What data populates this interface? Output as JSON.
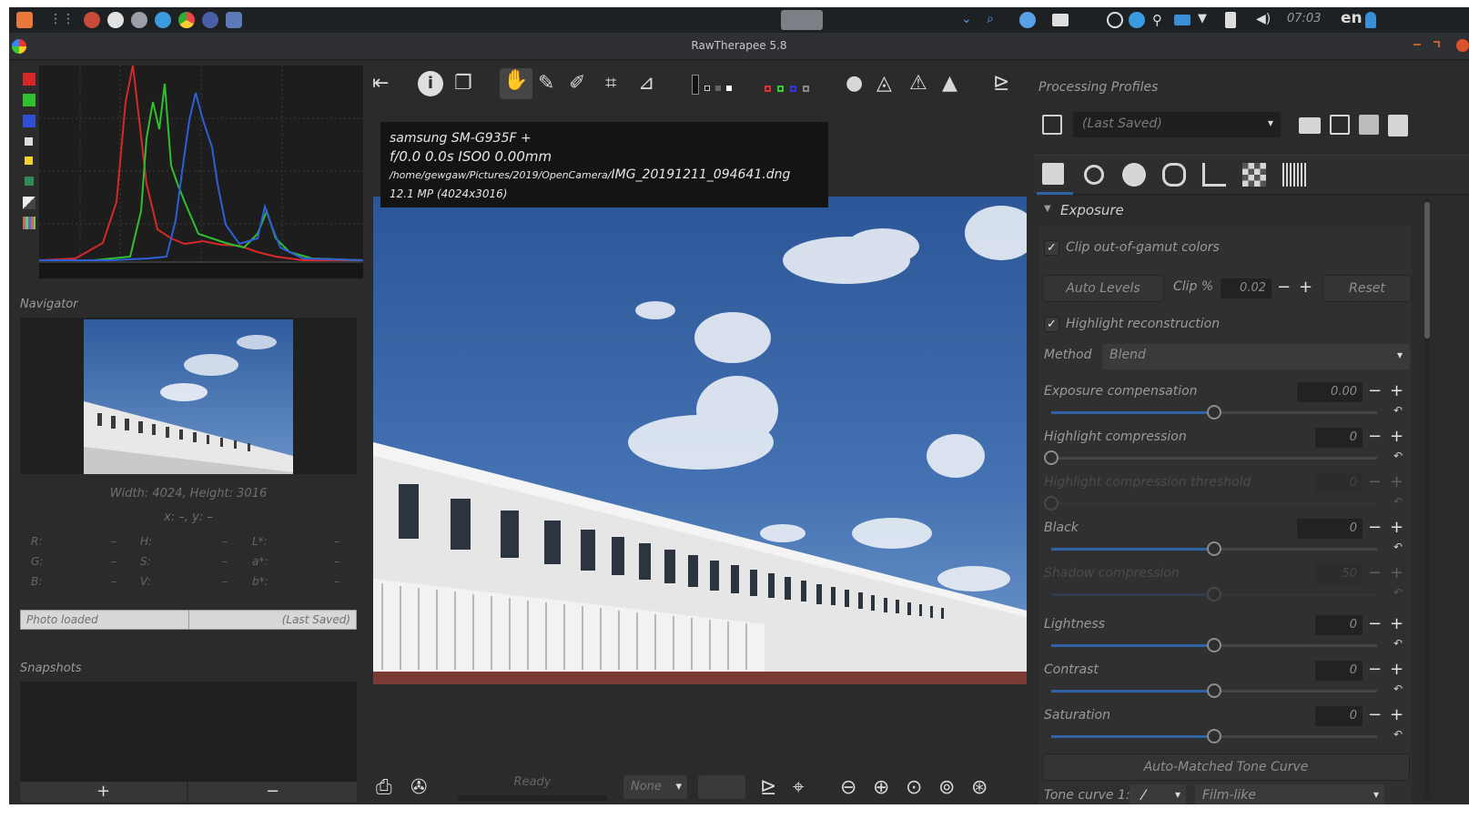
{
  "system_panel": {
    "clock": "07:03",
    "language": "en"
  },
  "window": {
    "title": "RawTherapee 5.8"
  },
  "left_panel": {
    "navigator_title": "Navigator",
    "dimensions": "Width: 4024, Height: 3016",
    "cursor": "x: –, y: –",
    "readouts": [
      {
        "label": "R:",
        "value": "–",
        "label2": "H:",
        "value2": "–",
        "label3": "L*:",
        "value3": "–"
      },
      {
        "label": "G:",
        "value": "–",
        "label2": "S:",
        "value2": "–",
        "label3": "a*:",
        "value3": "–"
      },
      {
        "label": "B:",
        "value": "–",
        "label2": "V:",
        "value2": "–",
        "label3": "b*:",
        "value3": "–"
      }
    ],
    "status_left": "Photo loaded",
    "status_right": "(Last Saved)",
    "snapshots_title": "Snapshots",
    "snapshot_add": "+",
    "snapshot_remove": "−"
  },
  "image_info": {
    "camera": "samsung SM-G935F +",
    "exposure": "f/0.0  0.0s  ISO0  0.00mm",
    "path_prefix": "/home/gewgaw/Pictures/2019/OpenCamera/",
    "filename": "IMG_20191211_094641.dng",
    "megapixels": "12.1 MP (4024x3016)"
  },
  "bottom_bar": {
    "queue_status": "Ready",
    "preview_select": "None"
  },
  "right_panel": {
    "profiles_title": "Processing Profiles",
    "profile_value": "(Last Saved)",
    "exposure_header": "Exposure",
    "clip_gamut_label": "Clip out-of-gamut colors",
    "auto_levels": "Auto Levels",
    "clip_label": "Clip %",
    "clip_value": "0.02",
    "reset_label": "Reset",
    "highlight_recon_label": "Highlight reconstruction",
    "method_label": "Method",
    "method_value": "Blend",
    "sliders": [
      {
        "label": "Exposure compensation",
        "value": "0.00",
        "position": 0.5,
        "enabled": true
      },
      {
        "label": "Highlight compression",
        "value": "0",
        "position": 0.0,
        "enabled": true
      },
      {
        "label": "Highlight compression threshold",
        "value": "0",
        "position": 0.0,
        "enabled": false
      },
      {
        "label": "Black",
        "value": "0",
        "position": 0.5,
        "enabled": true
      },
      {
        "label": "Shadow compression",
        "value": "50",
        "position": 0.5,
        "enabled": false
      },
      {
        "label": "Lightness",
        "value": "0",
        "position": 0.5,
        "enabled": true
      },
      {
        "label": "Contrast",
        "value": "0",
        "position": 0.5,
        "enabled": true
      },
      {
        "label": "Saturation",
        "value": "0",
        "position": 0.5,
        "enabled": true
      }
    ],
    "tone_curve_button": "Auto-Matched Tone Curve",
    "tone_curve_label": "Tone curve 1:",
    "tone_curve_mode": "Film-like"
  },
  "colors": {
    "accent": "#2f63a4",
    "sky": "#3f6aa8",
    "histogram_red": "#d62828",
    "histogram_green": "#34c934",
    "histogram_blue": "#2f5fd6"
  }
}
